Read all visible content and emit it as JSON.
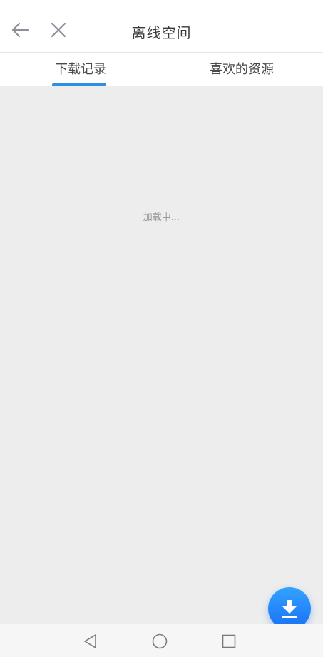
{
  "header": {
    "title": "离线空间",
    "back_icon": "arrow-left-icon",
    "close_icon": "close-icon"
  },
  "tabs": [
    {
      "label": "下载记录",
      "active": true
    },
    {
      "label": "喜欢的资源",
      "active": false
    }
  ],
  "content": {
    "loading_text": "加载中..."
  },
  "fab": {
    "icon": "download-icon"
  },
  "system_nav": {
    "back_icon": "triangle-back-icon",
    "home_icon": "circle-home-icon",
    "recent_icon": "square-recent-icon"
  },
  "colors": {
    "accent": "#2d8fe6",
    "fab_top": "#32a3ff",
    "fab_bottom": "#1a6ff5",
    "content_bg": "#ededed"
  }
}
